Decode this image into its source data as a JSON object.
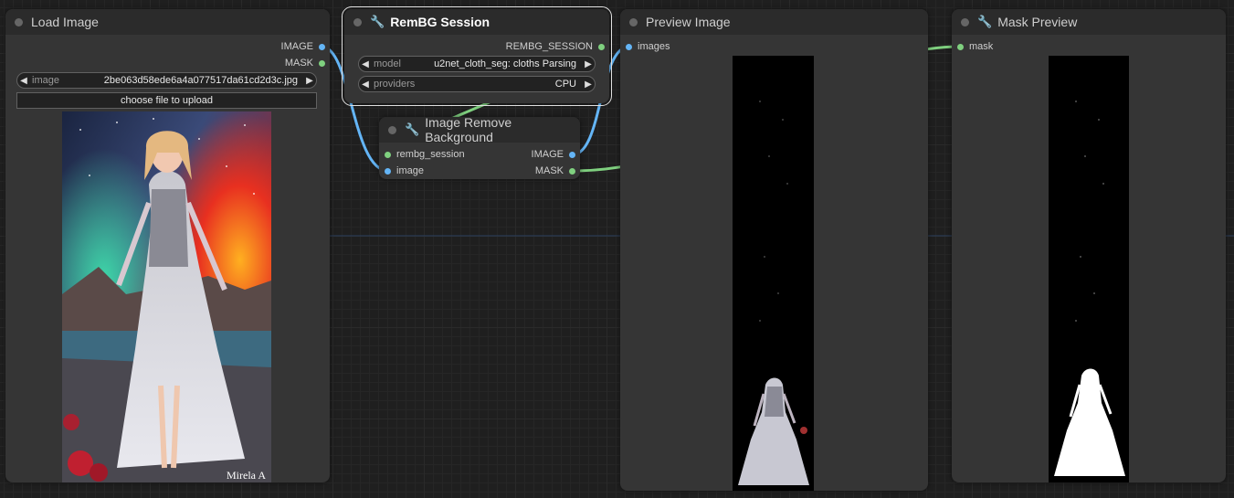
{
  "nodes": {
    "load_image": {
      "title": "Load Image",
      "outputs": {
        "image": "IMAGE",
        "mask": "MASK"
      },
      "widget_image": {
        "label": "image",
        "value": "2be063d58ede6a4a077517da61cd2d3c.jpg"
      },
      "upload_label": "choose file to upload",
      "watermark": "Mirela A"
    },
    "rembg_session": {
      "title": "RemBG Session",
      "outputs": {
        "session": "REMBG_SESSION"
      },
      "widget_model": {
        "label": "model",
        "value": "u2net_cloth_seg: cloths Parsing"
      },
      "widget_providers": {
        "label": "providers",
        "value": "CPU"
      }
    },
    "remove_bg": {
      "title": "Image Remove Background",
      "inputs": {
        "session": "rembg_session",
        "image": "image"
      },
      "outputs": {
        "image": "IMAGE",
        "mask": "MASK"
      }
    },
    "preview_image": {
      "title": "Preview Image",
      "inputs": {
        "images": "images"
      }
    },
    "mask_preview": {
      "title": "Mask Preview",
      "inputs": {
        "mask": "mask"
      }
    }
  },
  "colors": {
    "image_link": "#64b5f6",
    "mask_link": "#7fd07f",
    "session_link": "#ffffff",
    "node_bg": "#353535",
    "title_bg": "#2b2b2b"
  },
  "icons": [
    "wrench-icon",
    "arrow-left-icon",
    "arrow-right-icon"
  ]
}
